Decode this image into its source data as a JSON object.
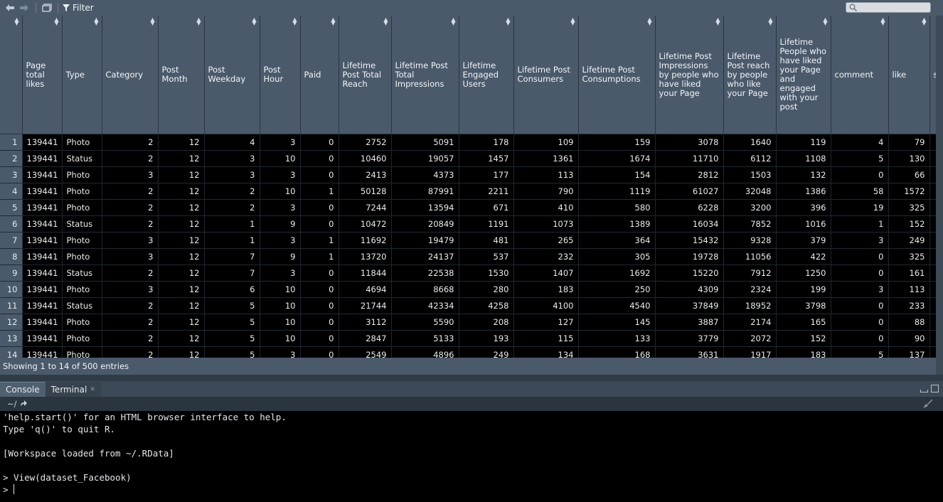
{
  "toolbar": {
    "filter_label": "Filter"
  },
  "columns": [
    {
      "label": "",
      "w": 31
    },
    {
      "label": "Page total likes",
      "w": 56
    },
    {
      "label": "Type",
      "w": 56
    },
    {
      "label": "Category",
      "w": 79
    },
    {
      "label": "Post Month",
      "w": 65
    },
    {
      "label": "Post Weekday",
      "w": 78
    },
    {
      "label": "Post Hour",
      "w": 57
    },
    {
      "label": "Paid",
      "w": 54
    },
    {
      "label": "Lifetime Post Total Reach",
      "w": 74
    },
    {
      "label": "Lifetime Post Total Impressions",
      "w": 95
    },
    {
      "label": "Lifetime Engaged Users",
      "w": 77
    },
    {
      "label": "Lifetime Post Consumers",
      "w": 91
    },
    {
      "label": "Lifetime Post Consumptions",
      "w": 108
    },
    {
      "label": "Lifetime Post Impressions by people who have liked your Page",
      "w": 96
    },
    {
      "label": "Lifetime Post reach by people who like your Page",
      "w": 74
    },
    {
      "label": "Lifetime People who have liked your Page and engaged with your post",
      "w": 77
    },
    {
      "label": "comment",
      "w": 81
    },
    {
      "label": "like",
      "w": 58
    },
    {
      "label": "share",
      "w": 40
    }
  ],
  "rows": [
    [
      "1",
      "139441",
      "Photo",
      "2",
      "12",
      "4",
      "3",
      "0",
      "2752",
      "5091",
      "178",
      "109",
      "159",
      "3078",
      "1640",
      "119",
      "4",
      "79",
      ""
    ],
    [
      "2",
      "139441",
      "Status",
      "2",
      "12",
      "3",
      "10",
      "0",
      "10460",
      "19057",
      "1457",
      "1361",
      "1674",
      "11710",
      "6112",
      "1108",
      "5",
      "130",
      ""
    ],
    [
      "3",
      "139441",
      "Photo",
      "3",
      "12",
      "3",
      "3",
      "0",
      "2413",
      "4373",
      "177",
      "113",
      "154",
      "2812",
      "1503",
      "132",
      "0",
      "66",
      ""
    ],
    [
      "4",
      "139441",
      "Photo",
      "2",
      "12",
      "2",
      "10",
      "1",
      "50128",
      "87991",
      "2211",
      "790",
      "1119",
      "61027",
      "32048",
      "1386",
      "58",
      "1572",
      ""
    ],
    [
      "5",
      "139441",
      "Photo",
      "2",
      "12",
      "2",
      "3",
      "0",
      "7244",
      "13594",
      "671",
      "410",
      "580",
      "6228",
      "3200",
      "396",
      "19",
      "325",
      ""
    ],
    [
      "6",
      "139441",
      "Status",
      "2",
      "12",
      "1",
      "9",
      "0",
      "10472",
      "20849",
      "1191",
      "1073",
      "1389",
      "16034",
      "7852",
      "1016",
      "1",
      "152",
      ""
    ],
    [
      "7",
      "139441",
      "Photo",
      "3",
      "12",
      "1",
      "3",
      "1",
      "11692",
      "19479",
      "481",
      "265",
      "364",
      "15432",
      "9328",
      "379",
      "3",
      "249",
      ""
    ],
    [
      "8",
      "139441",
      "Photo",
      "3",
      "12",
      "7",
      "9",
      "1",
      "13720",
      "24137",
      "537",
      "232",
      "305",
      "19728",
      "11056",
      "422",
      "0",
      "325",
      ""
    ],
    [
      "9",
      "139441",
      "Status",
      "2",
      "12",
      "7",
      "3",
      "0",
      "11844",
      "22538",
      "1530",
      "1407",
      "1692",
      "15220",
      "7912",
      "1250",
      "0",
      "161",
      ""
    ],
    [
      "10",
      "139441",
      "Photo",
      "3",
      "12",
      "6",
      "10",
      "0",
      "4694",
      "8668",
      "280",
      "183",
      "250",
      "4309",
      "2324",
      "199",
      "3",
      "113",
      ""
    ],
    [
      "11",
      "139441",
      "Status",
      "2",
      "12",
      "5",
      "10",
      "0",
      "21744",
      "42334",
      "4258",
      "4100",
      "4540",
      "37849",
      "18952",
      "3798",
      "0",
      "233",
      ""
    ],
    [
      "12",
      "139441",
      "Photo",
      "2",
      "12",
      "5",
      "10",
      "0",
      "3112",
      "5590",
      "208",
      "127",
      "145",
      "3887",
      "2174",
      "165",
      "0",
      "88",
      ""
    ],
    [
      "13",
      "139441",
      "Photo",
      "2",
      "12",
      "5",
      "10",
      "0",
      "2847",
      "5133",
      "193",
      "115",
      "133",
      "3779",
      "2072",
      "152",
      "0",
      "90",
      ""
    ],
    [
      "14",
      "139441",
      "Photo",
      "2",
      "12",
      "5",
      "3",
      "0",
      "2549",
      "4896",
      "249",
      "134",
      "168",
      "3631",
      "1917",
      "183",
      "5",
      "137",
      ""
    ]
  ],
  "status": {
    "text": "Showing 1 to 14 of 500 entries"
  },
  "console": {
    "tab_console": "Console",
    "tab_terminal": "Terminal",
    "path": "~/",
    "lines": [
      "'help.start()' for an HTML browser interface to help.",
      "Type 'q()' to quit R.",
      "",
      "[Workspace loaded from ~/.RData]",
      "",
      "> View(dataset_Facebook)",
      "> "
    ]
  },
  "colors": {
    "header_bg": "#4a5a6b",
    "grid_bg": "#000000"
  },
  "icons": [
    "back-arrow-icon",
    "forward-arrow-icon",
    "popout-icon",
    "filter-icon",
    "search-icon",
    "sort-icon",
    "go-to-dir-icon",
    "broom-icon"
  ]
}
